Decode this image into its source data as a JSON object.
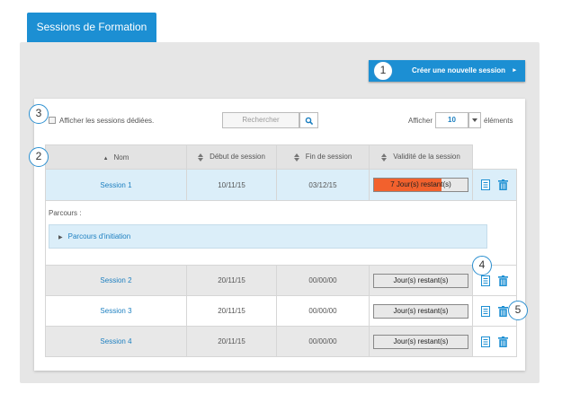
{
  "tab": {
    "title": "Sessions de Formation"
  },
  "create_button": {
    "label": "Créer une nouvelle session",
    "arrow": "▸"
  },
  "callouts": [
    "1",
    "2",
    "3",
    "4",
    "5"
  ],
  "filters": {
    "dedicated_label": "Afficher les sessions dédiées.",
    "search_placeholder": "Rechercher",
    "show_label": "Afficher",
    "page_size": "10",
    "elements_label": "éléments"
  },
  "table": {
    "headers": {
      "name": "Nom",
      "start": "Début de session",
      "end": "Fin de session",
      "validity": "Validité de la session"
    },
    "rows": [
      {
        "name": "Session 1",
        "start": "10/11/15",
        "end": "03/12/15",
        "validity": "7 Jour(s) restant(s)",
        "progress": 0.72
      },
      {
        "name": "Session 2",
        "start": "20/11/15",
        "end": "00/00/00",
        "validity": "Jour(s) restant(s)",
        "progress": 0
      },
      {
        "name": "Session 3",
        "start": "20/11/15",
        "end": "00/00/00",
        "validity": "Jour(s) restant(s)",
        "progress": 0
      },
      {
        "name": "Session 4",
        "start": "20/11/15",
        "end": "00/00/00",
        "validity": "Jour(s) restant(s)",
        "progress": 0
      }
    ],
    "detail": {
      "label": "Parcours :",
      "item": "Parcours d'initiation"
    }
  },
  "colors": {
    "primary": "#1c8fd3",
    "link": "#1c7fc0",
    "selected_row": "#dbeef9",
    "progress_fill": "#f2612d"
  }
}
